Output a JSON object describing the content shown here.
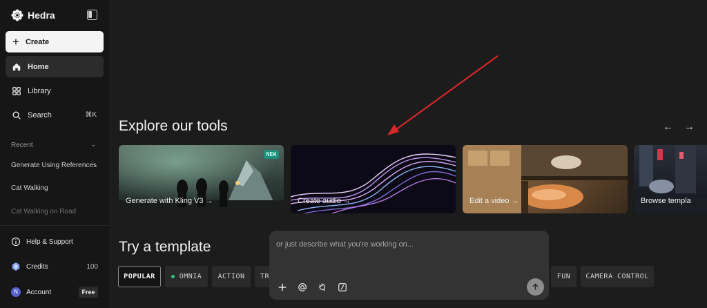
{
  "sidebar": {
    "brand": "Hedra",
    "create_label": "Create",
    "nav": [
      {
        "label": "Home"
      },
      {
        "label": "Library"
      },
      {
        "label": "Search",
        "shortcut": "⌘K"
      }
    ],
    "recent_label": "Recent",
    "recent_items": [
      "Generate Using References",
      "Cat Walking",
      "Cat Walking on Road"
    ],
    "help_label": "Help & Support",
    "credits_label": "Credits",
    "credits_count": "100",
    "account_label": "Account",
    "account_initial": "N",
    "plan_badge": "Free"
  },
  "tools": {
    "title": "Explore our tools",
    "cards": [
      {
        "label": "Generate with Kling V3 →",
        "badge": "NEW"
      },
      {
        "label": "Create audio →"
      },
      {
        "label": "Edit a video →"
      },
      {
        "label": "Browse templa"
      }
    ]
  },
  "templates": {
    "title": "Try a template",
    "chips": [
      "POPULAR",
      "OMNIA",
      "ACTION",
      "TR",
      "FUN",
      "CAMERA CONTROL"
    ]
  },
  "prompt": {
    "placeholder": "or just describe what you're working on..."
  },
  "colors": {
    "accent_new": "#1f8f79",
    "annotation_arrow": "#d8262b",
    "omnia_dot": "#35c27d"
  }
}
